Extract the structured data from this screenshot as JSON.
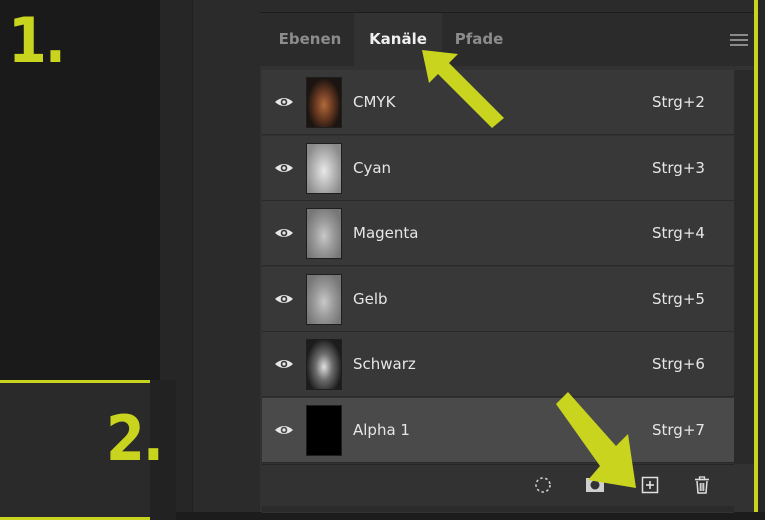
{
  "steps": {
    "one": "1.",
    "two": "2."
  },
  "tabs": [
    {
      "label": "Ebenen",
      "active": false
    },
    {
      "label": "Kanäle",
      "active": true
    },
    {
      "label": "Pfade",
      "active": false
    }
  ],
  "channels": [
    {
      "name": "CMYK",
      "shortcut": "Strg+2",
      "selected": false,
      "thumb": "color"
    },
    {
      "name": "Cyan",
      "shortcut": "Strg+3",
      "selected": false,
      "thumb": "gray-light"
    },
    {
      "name": "Magenta",
      "shortcut": "Strg+4",
      "selected": false,
      "thumb": "gray-mid"
    },
    {
      "name": "Gelb",
      "shortcut": "Strg+5",
      "selected": false,
      "thumb": "gray-mid"
    },
    {
      "name": "Schwarz",
      "shortcut": "Strg+6",
      "selected": false,
      "thumb": "gray-dark"
    },
    {
      "name": "Alpha 1",
      "shortcut": "Strg+7",
      "selected": true,
      "thumb": "black"
    }
  ],
  "icons": {
    "visibility": "eye-icon",
    "load_selection": "dotted-circle-icon",
    "save_selection": "mask-icon",
    "new_channel": "plus-square-icon",
    "delete": "trash-icon",
    "panel_menu": "hamburger-icon"
  },
  "colors": {
    "accent": "#c8d41e",
    "panel": "#323232",
    "row": "#383838",
    "row_selected": "#4a4a4a"
  }
}
